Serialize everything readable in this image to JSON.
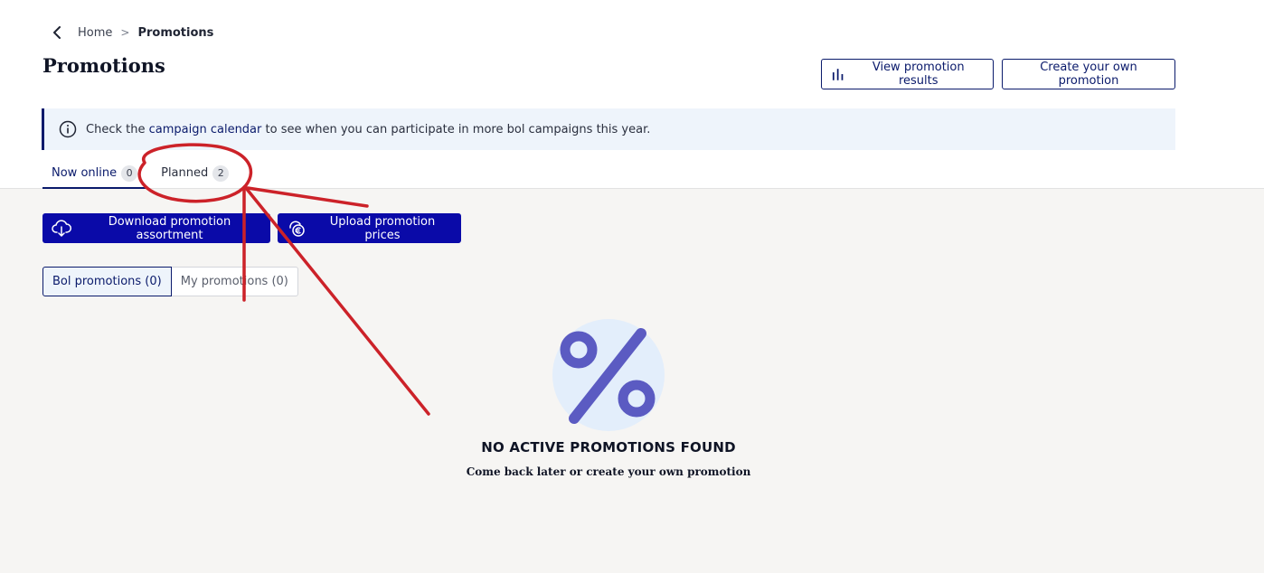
{
  "breadcrumb": {
    "back_icon": "chevron-left-icon",
    "home": "Home",
    "separator": ">",
    "current": "Promotions"
  },
  "page": {
    "title": "Promotions"
  },
  "header_actions": {
    "view_results": {
      "label": "View promotion results",
      "icon": "bar-chart-icon"
    },
    "create": {
      "label": "Create your own promotion"
    }
  },
  "info_banner": {
    "icon": "info-icon",
    "prefix": "Check the",
    "link": "campaign calendar",
    "suffix": "to see when you can participate in more bol campaigns this year."
  },
  "tabs": [
    {
      "label": "Now online",
      "count": "0",
      "active": true
    },
    {
      "label": "Planned",
      "count": "2",
      "active": false
    }
  ],
  "actions": {
    "download": {
      "label": "Download promotion assortment",
      "icon": "cloud-download-icon"
    },
    "upload": {
      "label": "Upload promotion prices",
      "icon": "euro-upload-icon"
    }
  },
  "filters": [
    {
      "label": "Bol promotions (0)",
      "active": true
    },
    {
      "label": "My promotions (0)",
      "active": false
    }
  ],
  "empty_state": {
    "icon": "percent-icon",
    "title": "NO ACTIVE PROMOTIONS FOUND",
    "subtitle": "Come back later or create your own promotion"
  },
  "colors": {
    "primary": "#0a0aa8",
    "navy": "#0a1a6b",
    "info_bg": "#eef4fb",
    "content_bg": "#f6f5f3",
    "percent_icon": "#5b5bc2",
    "annotation_red": "#cc2229"
  }
}
